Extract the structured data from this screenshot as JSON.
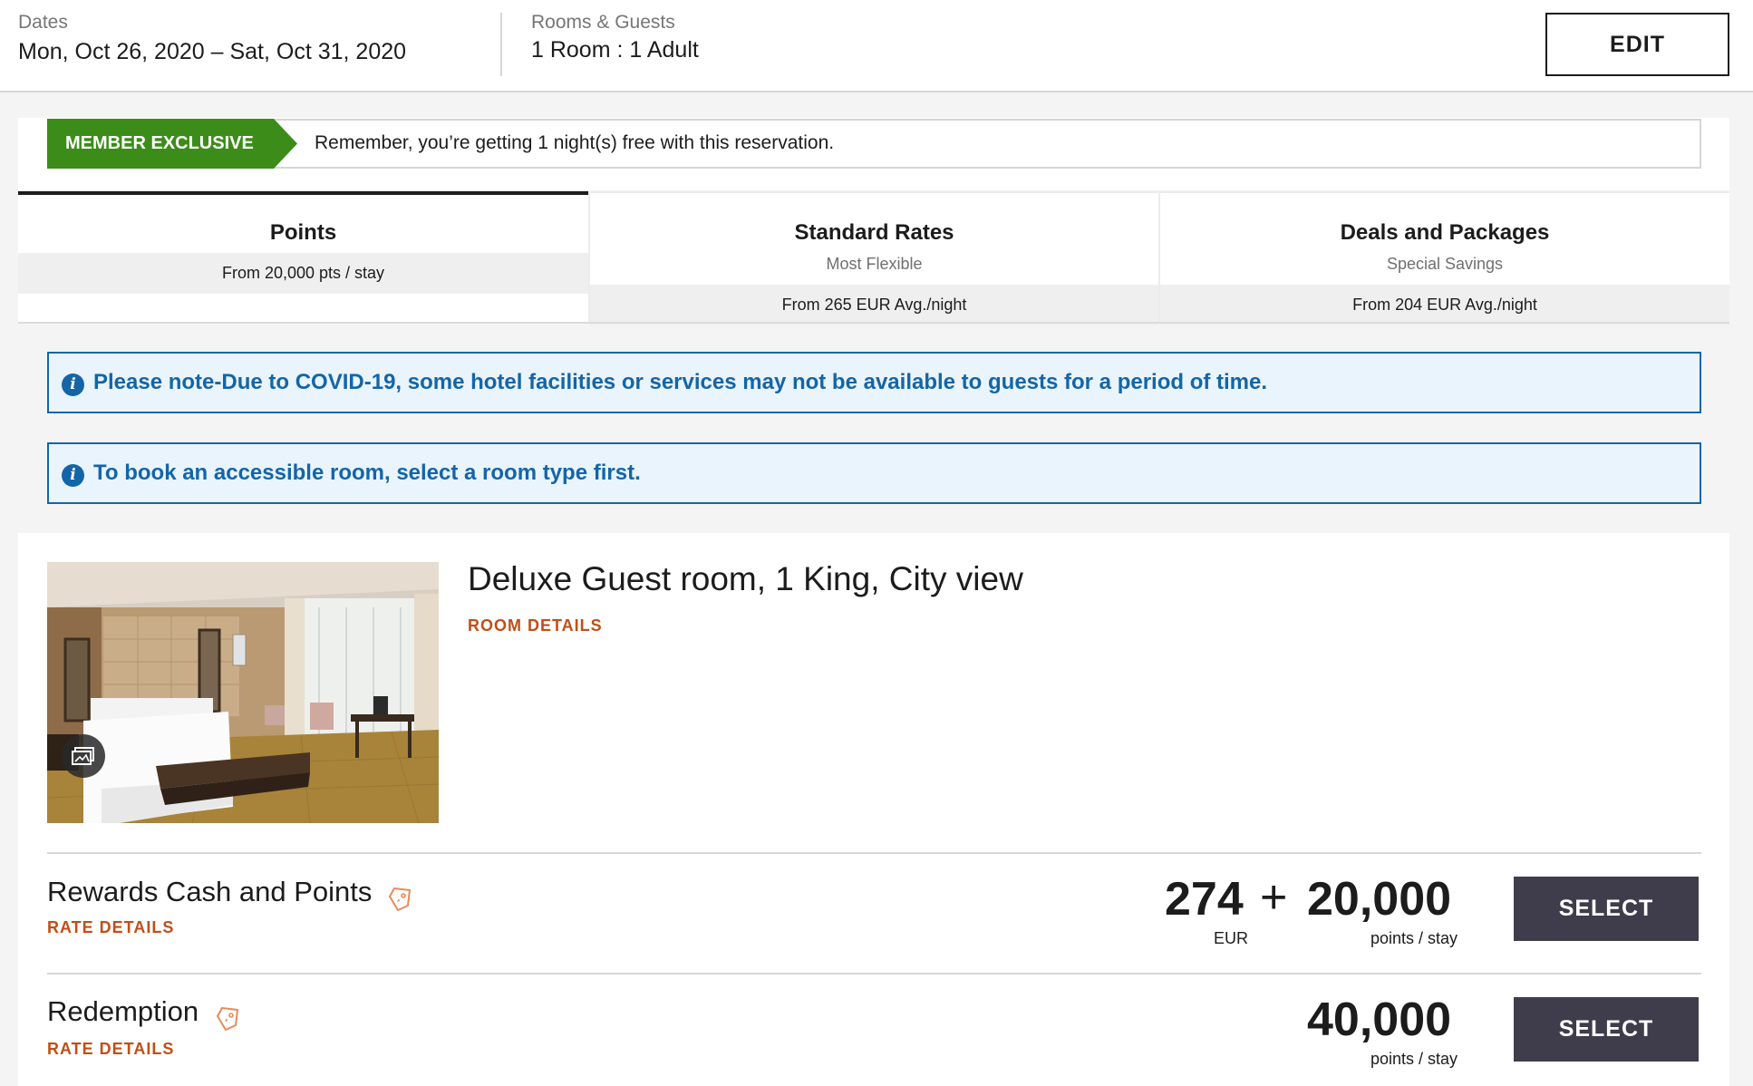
{
  "header": {
    "dates_label": "Dates",
    "dates_value": "Mon, Oct 26, 2020 – Sat, Oct 31, 2020",
    "guests_label": "Rooms & Guests",
    "guests_value": "1 Room : 1 Adult",
    "edit_label": "EDIT"
  },
  "member": {
    "badge": "MEMBER EXCLUSIVE",
    "message": "Remember, you’re getting 1 night(s) free with this reservation.",
    "badge_color": "#3c8c1a"
  },
  "tabs": [
    {
      "title": "Points",
      "subtitle": "",
      "from": "From 20,000 pts / stay",
      "active": true
    },
    {
      "title": "Standard Rates",
      "subtitle": "Most Flexible",
      "from": "From 265 EUR Avg./night",
      "active": false
    },
    {
      "title": "Deals and Packages",
      "subtitle": "Special Savings",
      "from": "From 204 EUR Avg./night",
      "active": false
    }
  ],
  "notices": [
    {
      "icon": "info-icon",
      "text": "Please note-Due to COVID-19, some hotel facilities or services may not be available to guests for a period of time."
    },
    {
      "icon": "info-icon",
      "text": "To book an accessible room, select a room type first."
    }
  ],
  "room": {
    "title": "Deluxe Guest room, 1 King, City view",
    "details_link": "ROOM DETAILS",
    "gallery_icon": "gallery-icon"
  },
  "rates": [
    {
      "name": "Rewards Cash and Points",
      "link": "RATE DETAILS",
      "cash": "274",
      "plus": "+",
      "points": "20,000",
      "cash_unit": "EUR",
      "points_unit": "points / stay",
      "select_label": "SELECT"
    },
    {
      "name": "Redemption",
      "link": "RATE DETAILS",
      "points": "40,000",
      "points_unit": "points / stay",
      "select_label": "SELECT"
    }
  ],
  "colors": {
    "link": "#c24e17",
    "notice": "#1465a8",
    "select_button": "#3f3c4b"
  }
}
